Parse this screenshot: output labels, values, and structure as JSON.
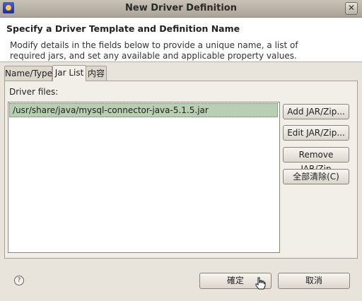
{
  "window": {
    "title": "New Driver Definition",
    "close_glyph": "✕"
  },
  "banner": {
    "title": "Specify a Driver Template and Definition Name",
    "description": "Modify details in the fields below to provide a unique name, a list of required jars, and set any available and applicable property values."
  },
  "tabs": [
    {
      "label": "Name/Type",
      "active": false
    },
    {
      "label": "Jar List",
      "active": true
    },
    {
      "label": "内容",
      "active": false
    }
  ],
  "jar_list": {
    "label": "Driver files:",
    "files": [
      "/usr/share/java/mysql-connector-java-5.1.5.jar"
    ],
    "buttons": {
      "add": "Add JAR/Zip...",
      "edit": "Edit JAR/Zip...",
      "remove": "Remove JAR/Zip",
      "clear_all": "全部清除(C)"
    }
  },
  "footer": {
    "help_glyph": "?",
    "ok": "確定",
    "cancel": "取消"
  },
  "icons": {
    "app": "app-icon",
    "help": "help-icon",
    "cursor": "hand-cursor-icon"
  },
  "colors": {
    "selection": "#b8cfb3",
    "dialog_bg": "#e8e4dc",
    "banner_bg": "#ffffff"
  }
}
